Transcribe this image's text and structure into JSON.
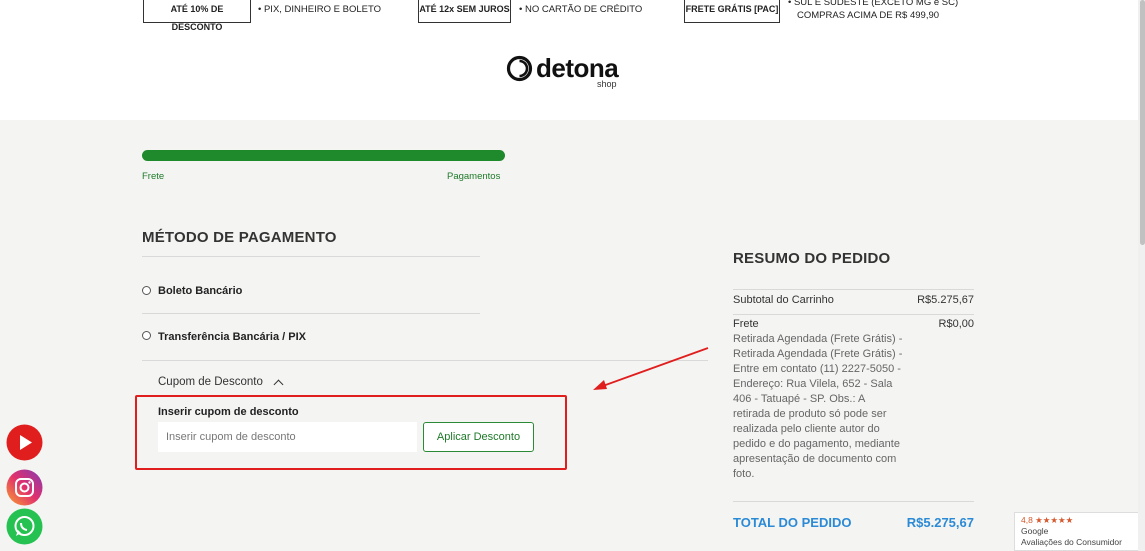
{
  "promos": [
    {
      "box": "ATÉ 10% DE DESCONTO",
      "text": "• PIX, DINHEIRO E BOLETO"
    },
    {
      "box": "ATÉ 12x SEM JUROS",
      "text": "• NO CARTÃO DE CRÉDITO"
    },
    {
      "box": "FRETE GRÁTIS [PAC]",
      "text_line1": "• SUL E SUDESTE (EXCETO MG e SC)",
      "text_line2": "COMPRAS ACIMA DE R$ 499,90"
    }
  ],
  "logo": {
    "word": "detona",
    "sub": "shop"
  },
  "progress": {
    "fraction": 1.0,
    "steps": [
      "Frete",
      "Pagamentos"
    ]
  },
  "payment": {
    "title": "MÉTODO DE PAGAMENTO",
    "options": [
      "Boleto Bancário",
      "Transferência Bancária / PIX"
    ]
  },
  "coupon": {
    "toggle_label": "Cupom de Desconto",
    "field_label": "Inserir cupom de desconto",
    "placeholder": "Inserir cupom de desconto",
    "button_label": "Aplicar Desconto"
  },
  "summary": {
    "title": "RESUMO DO PEDIDO",
    "subtotal_label": "Subtotal do Carrinho",
    "subtotal_value": "R$5.275,67",
    "shipping_label": "Frete",
    "shipping_value": "R$0,00",
    "shipping_description": "Retirada Agendada (Frete Grátis) - Retirada Agendada (Frete Grátis) - Entre em contato (11) 2227-5050 - Endereço: Rua Vilela, 652 - Sala 406 - Tatuapé - SP. Obs.: A retirada de produto só pode ser realizada pelo cliente autor do pedido e do pagamento, mediante apresentação de documento com foto.",
    "total_label": "TOTAL DO PEDIDO",
    "total_value": "R$5.275,67"
  },
  "social_icons": [
    "youtube-icon",
    "instagram-icon",
    "whatsapp-icon"
  ],
  "review_badge": {
    "rating": "4,8 ★★★★★",
    "line1": "Google",
    "line2": "Avaliações do Consumidor"
  },
  "colors": {
    "accent_green": "#1e8a2c",
    "highlight_red": "#e01e1e",
    "total_blue": "#2b8ad6"
  }
}
